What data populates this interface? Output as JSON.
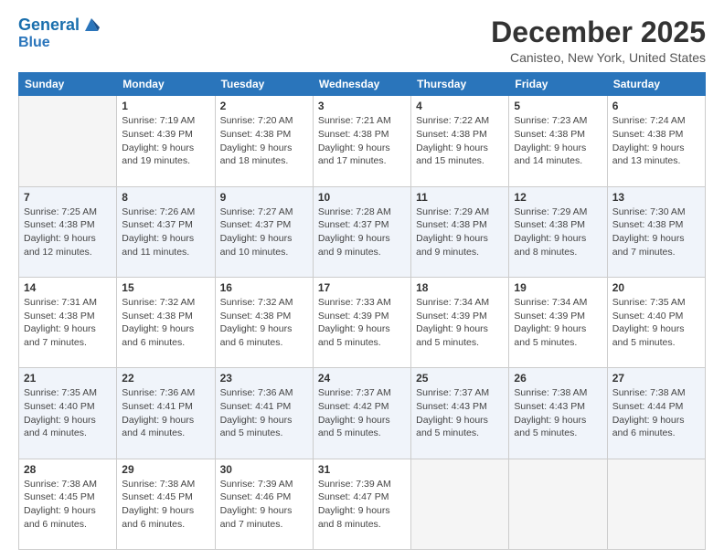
{
  "header": {
    "logo_line1": "General",
    "logo_line2": "Blue",
    "month": "December 2025",
    "location": "Canisteo, New York, United States"
  },
  "days_of_week": [
    "Sunday",
    "Monday",
    "Tuesday",
    "Wednesday",
    "Thursday",
    "Friday",
    "Saturday"
  ],
  "weeks": [
    [
      {
        "day": "",
        "empty": true
      },
      {
        "day": "1",
        "sunrise": "7:19 AM",
        "sunset": "4:39 PM",
        "daylight": "9 hours and 19 minutes."
      },
      {
        "day": "2",
        "sunrise": "7:20 AM",
        "sunset": "4:38 PM",
        "daylight": "9 hours and 18 minutes."
      },
      {
        "day": "3",
        "sunrise": "7:21 AM",
        "sunset": "4:38 PM",
        "daylight": "9 hours and 17 minutes."
      },
      {
        "day": "4",
        "sunrise": "7:22 AM",
        "sunset": "4:38 PM",
        "daylight": "9 hours and 15 minutes."
      },
      {
        "day": "5",
        "sunrise": "7:23 AM",
        "sunset": "4:38 PM",
        "daylight": "9 hours and 14 minutes."
      },
      {
        "day": "6",
        "sunrise": "7:24 AM",
        "sunset": "4:38 PM",
        "daylight": "9 hours and 13 minutes."
      }
    ],
    [
      {
        "day": "7",
        "sunrise": "7:25 AM",
        "sunset": "4:38 PM",
        "daylight": "9 hours and 12 minutes."
      },
      {
        "day": "8",
        "sunrise": "7:26 AM",
        "sunset": "4:37 PM",
        "daylight": "9 hours and 11 minutes."
      },
      {
        "day": "9",
        "sunrise": "7:27 AM",
        "sunset": "4:37 PM",
        "daylight": "9 hours and 10 minutes."
      },
      {
        "day": "10",
        "sunrise": "7:28 AM",
        "sunset": "4:37 PM",
        "daylight": "9 hours and 9 minutes."
      },
      {
        "day": "11",
        "sunrise": "7:29 AM",
        "sunset": "4:38 PM",
        "daylight": "9 hours and 9 minutes."
      },
      {
        "day": "12",
        "sunrise": "7:29 AM",
        "sunset": "4:38 PM",
        "daylight": "9 hours and 8 minutes."
      },
      {
        "day": "13",
        "sunrise": "7:30 AM",
        "sunset": "4:38 PM",
        "daylight": "9 hours and 7 minutes."
      }
    ],
    [
      {
        "day": "14",
        "sunrise": "7:31 AM",
        "sunset": "4:38 PM",
        "daylight": "9 hours and 7 minutes."
      },
      {
        "day": "15",
        "sunrise": "7:32 AM",
        "sunset": "4:38 PM",
        "daylight": "9 hours and 6 minutes."
      },
      {
        "day": "16",
        "sunrise": "7:32 AM",
        "sunset": "4:38 PM",
        "daylight": "9 hours and 6 minutes."
      },
      {
        "day": "17",
        "sunrise": "7:33 AM",
        "sunset": "4:39 PM",
        "daylight": "9 hours and 5 minutes."
      },
      {
        "day": "18",
        "sunrise": "7:34 AM",
        "sunset": "4:39 PM",
        "daylight": "9 hours and 5 minutes."
      },
      {
        "day": "19",
        "sunrise": "7:34 AM",
        "sunset": "4:39 PM",
        "daylight": "9 hours and 5 minutes."
      },
      {
        "day": "20",
        "sunrise": "7:35 AM",
        "sunset": "4:40 PM",
        "daylight": "9 hours and 5 minutes."
      }
    ],
    [
      {
        "day": "21",
        "sunrise": "7:35 AM",
        "sunset": "4:40 PM",
        "daylight": "9 hours and 4 minutes."
      },
      {
        "day": "22",
        "sunrise": "7:36 AM",
        "sunset": "4:41 PM",
        "daylight": "9 hours and 4 minutes."
      },
      {
        "day": "23",
        "sunrise": "7:36 AM",
        "sunset": "4:41 PM",
        "daylight": "9 hours and 5 minutes."
      },
      {
        "day": "24",
        "sunrise": "7:37 AM",
        "sunset": "4:42 PM",
        "daylight": "9 hours and 5 minutes."
      },
      {
        "day": "25",
        "sunrise": "7:37 AM",
        "sunset": "4:43 PM",
        "daylight": "9 hours and 5 minutes."
      },
      {
        "day": "26",
        "sunrise": "7:38 AM",
        "sunset": "4:43 PM",
        "daylight": "9 hours and 5 minutes."
      },
      {
        "day": "27",
        "sunrise": "7:38 AM",
        "sunset": "4:44 PM",
        "daylight": "9 hours and 6 minutes."
      }
    ],
    [
      {
        "day": "28",
        "sunrise": "7:38 AM",
        "sunset": "4:45 PM",
        "daylight": "9 hours and 6 minutes."
      },
      {
        "day": "29",
        "sunrise": "7:38 AM",
        "sunset": "4:45 PM",
        "daylight": "9 hours and 6 minutes."
      },
      {
        "day": "30",
        "sunrise": "7:39 AM",
        "sunset": "4:46 PM",
        "daylight": "9 hours and 7 minutes."
      },
      {
        "day": "31",
        "sunrise": "7:39 AM",
        "sunset": "4:47 PM",
        "daylight": "9 hours and 8 minutes."
      },
      {
        "day": "",
        "empty": true
      },
      {
        "day": "",
        "empty": true
      },
      {
        "day": "",
        "empty": true
      }
    ]
  ]
}
